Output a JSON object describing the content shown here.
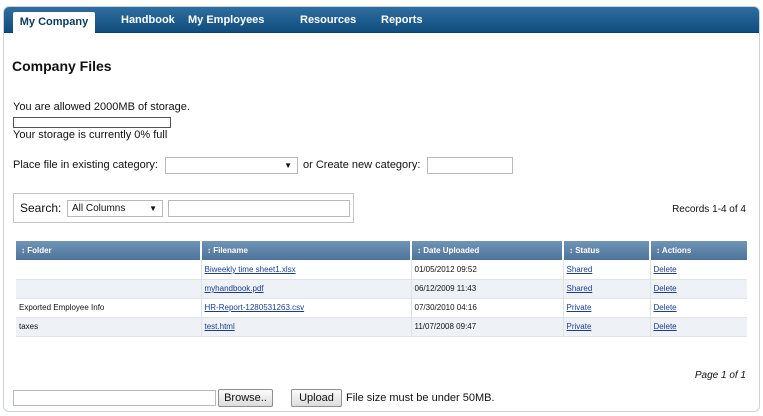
{
  "nav": {
    "items": [
      {
        "label": "My Company",
        "active": true
      },
      {
        "label": "Handbook"
      },
      {
        "label": "My Employees"
      },
      {
        "label": "Resources"
      },
      {
        "label": "Reports"
      }
    ]
  },
  "page": {
    "title": "Company Files"
  },
  "storage": {
    "allowed_text": "You are allowed 2000MB of storage.",
    "used_percent": 0,
    "status_text": "Your storage is currently 0% full"
  },
  "category": {
    "existing_label": "Place file in existing category:",
    "existing_value": "",
    "create_label": "or Create new category:",
    "new_value": ""
  },
  "search": {
    "label": "Search:",
    "column_value": "All Columns",
    "query": ""
  },
  "records_text": "Records 1-4 of 4",
  "table": {
    "columns": [
      "↕ Folder",
      "↕ Filename",
      "↕ Date Uploaded",
      "↕ Status",
      "↕ Actions"
    ],
    "rows": [
      {
        "folder": "",
        "filename": "Biweekly time sheet1.xlsx",
        "date": "01/05/2012 09:52",
        "status": "Shared",
        "action": "Delete"
      },
      {
        "folder": "",
        "filename": "myhandbook.pdf",
        "date": "06/12/2009 11:43",
        "status": "Shared",
        "action": "Delete"
      },
      {
        "folder": "Exported Employee Info",
        "filename": "HR-Report-1280531263.csv",
        "date": "07/30/2010 04:16",
        "status": "Private",
        "action": "Delete"
      },
      {
        "folder": "taxes",
        "filename": "test.html",
        "date": "11/07/2008 09:47",
        "status": "Private",
        "action": "Delete"
      }
    ]
  },
  "pagination": "Page 1 of 1",
  "upload": {
    "browse_label": "Browse..",
    "upload_label": "Upload",
    "note": "File size must be under 50MB."
  },
  "colors": {
    "nav_bg": "#1a5a8c",
    "header_bg": "#5d82a7",
    "link": "#1a3d8f",
    "alt_row": "#eef2f6"
  }
}
